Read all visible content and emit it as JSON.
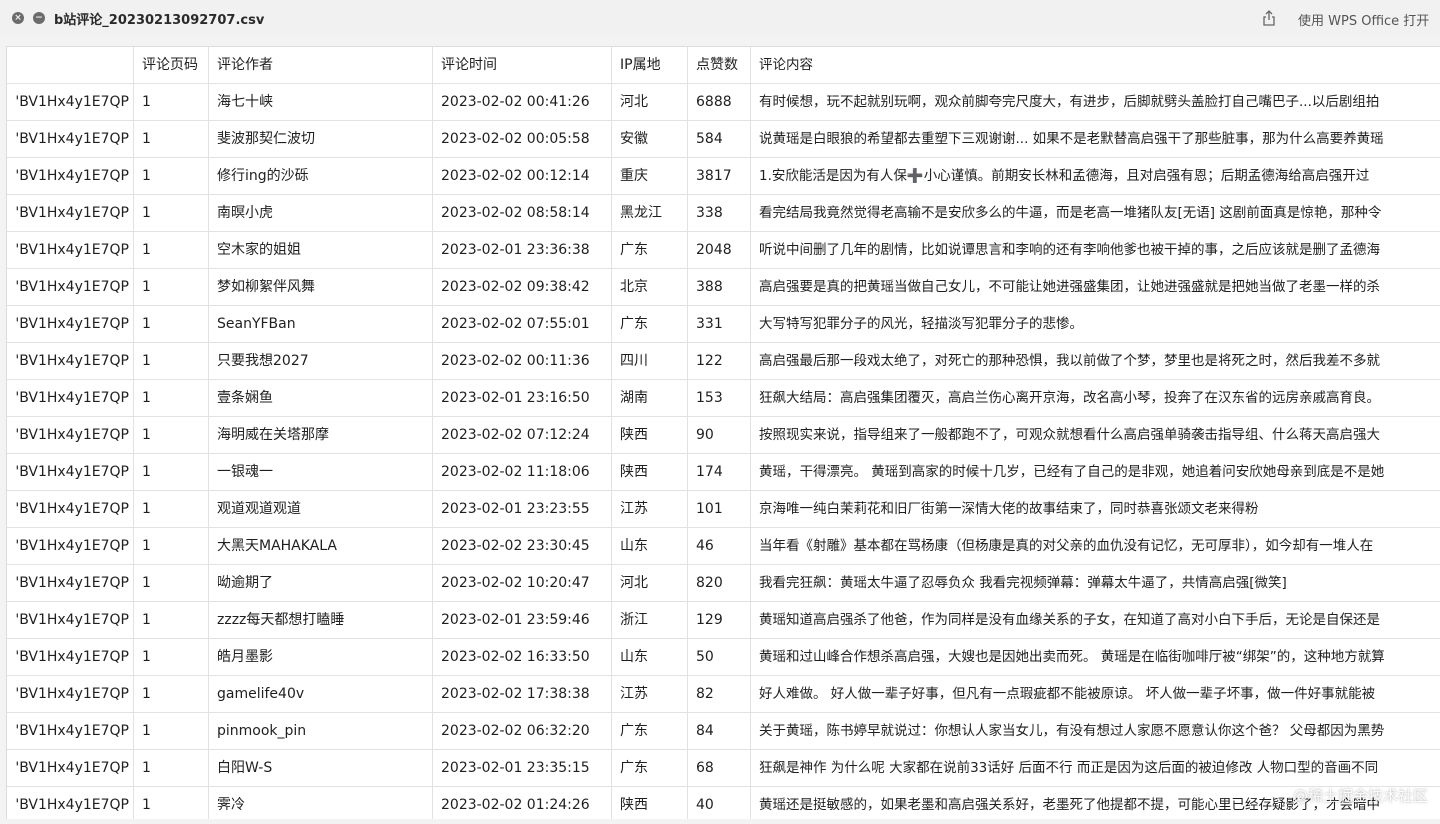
{
  "window": {
    "title": "b站评论_20230213092707.csv",
    "open_with_label": "使用 WPS Office 打开",
    "close_glyph": "×",
    "minimize_glyph": "−",
    "share_icon": "share-icon"
  },
  "table": {
    "headers": [
      "",
      "评论页码",
      "评论作者",
      "评论时间",
      "IP属地",
      "点赞数",
      "评论内容"
    ],
    "rows": [
      [
        "'BV1Hx4y1E7QP",
        "1",
        "海七十峡",
        "2023-02-02 00:41:26",
        "河北",
        "6888",
        "有时候想，玩不起就别玩啊，观众前脚夸完尺度大，有进步，后脚就劈头盖脸打自己嘴巴子...以后剧组拍"
      ],
      [
        "'BV1Hx4y1E7QP",
        "1",
        "斐波那契仁波切",
        "2023-02-02 00:05:58",
        "安徽",
        "584",
        "说黄瑶是白眼狼的希望都去重塑下三观谢谢... 如果不是老默替高启强干了那些脏事，那为什么高要养黄瑶"
      ],
      [
        "'BV1Hx4y1E7QP",
        "1",
        "修行ing的沙砾",
        "2023-02-02 00:12:14",
        "重庆",
        "3817",
        "1.安欣能活是因为有人保➕小心谨慎。前期安长林和孟德海，且对启强有恩；后期孟德海给高启强开过"
      ],
      [
        "'BV1Hx4y1E7QP",
        "1",
        "南暝小虎",
        "2023-02-02 08:58:14",
        "黑龙江",
        "338",
        "看完结局我竟然觉得老高输不是安欣多么的牛逼，而是老高一堆猪队友[无语] 这剧前面真是惊艳，那种令"
      ],
      [
        "'BV1Hx4y1E7QP",
        "1",
        "空木家的姐姐",
        "2023-02-01 23:36:38",
        "广东",
        "2048",
        "听说中间删了几年的剧情，比如说谭思言和李响的还有李响他爹也被干掉的事，之后应该就是删了孟德海"
      ],
      [
        "'BV1Hx4y1E7QP",
        "1",
        "梦如柳絮伴风舞",
        "2023-02-02 09:38:42",
        "北京",
        "388",
        "高启强要是真的把黄瑶当做自己女儿，不可能让她进强盛集团，让她进强盛就是把她当做了老墨一样的杀"
      ],
      [
        "'BV1Hx4y1E7QP",
        "1",
        "SeanYFBan",
        "2023-02-02 07:55:01",
        "广东",
        "331",
        "大写特写犯罪分子的风光，轻描淡写犯罪分子的悲惨。"
      ],
      [
        "'BV1Hx4y1E7QP",
        "1",
        "只要我想2027",
        "2023-02-02 00:11:36",
        "四川",
        "122",
        "高启强最后那一段戏太绝了，对死亡的那种恐惧，我以前做了个梦，梦里也是将死之时，然后我差不多就"
      ],
      [
        "'BV1Hx4y1E7QP",
        "1",
        "壹条娴鱼",
        "2023-02-01 23:16:50",
        "湖南",
        "153",
        "狂飙大结局：高启强集团覆灭，高启兰伤心离开京海，改名高小琴，投奔了在汉东省的远房亲戚高育良。"
      ],
      [
        "'BV1Hx4y1E7QP",
        "1",
        "海明威在关塔那摩",
        "2023-02-02 07:12:24",
        "陕西",
        "90",
        "按照现实来说，指导组来了一般都跑不了，可观众就想看什么高启强单骑袭击指导组、什么蒋天高启强大"
      ],
      [
        "'BV1Hx4y1E7QP",
        "1",
        "一银魂一",
        "2023-02-02 11:18:06",
        "陕西",
        "174",
        "黄瑶，干得漂亮。 黄瑶到高家的时候十几岁，已经有了自己的是非观，她追着问安欣她母亲到底是不是她"
      ],
      [
        "'BV1Hx4y1E7QP",
        "1",
        "观道观道观道",
        "2023-02-01 23:23:55",
        "江苏",
        "101",
        "京海唯一纯白茉莉花和旧厂街第一深情大佬的故事结束了，同时恭喜张颂文老来得粉"
      ],
      [
        "'BV1Hx4y1E7QP",
        "1",
        "大黑天MAHAKALA",
        "2023-02-02 23:30:45",
        "山东",
        "46",
        "当年看《射雕》基本都在骂杨康（但杨康是真的对父亲的血仇没有记忆，无可厚非），如今却有一堆人在"
      ],
      [
        "'BV1Hx4y1E7QP",
        "1",
        "呦逾期了",
        "2023-02-02 10:20:47",
        "河北",
        "820",
        "我看完狂飙：黄瑶太牛逼了忍辱负众 我看完视频弹幕：弹幕太牛逼了，共情高启强[微笑]"
      ],
      [
        "'BV1Hx4y1E7QP",
        "1",
        "zzzz每天都想打瞌睡",
        "2023-02-01 23:59:46",
        "浙江",
        "129",
        "黄瑶知道高启强杀了他爸，作为同样是没有血缘关系的子女，在知道了高对小白下手后，无论是自保还是"
      ],
      [
        "'BV1Hx4y1E7QP",
        "1",
        "皓月墨影",
        "2023-02-02 16:33:50",
        "山东",
        "50",
        "黄瑶和过山峰合作想杀高启强，大嫂也是因她出卖而死。 黄瑶是在临街咖啡厅被“绑架”的，这种地方就算"
      ],
      [
        "'BV1Hx4y1E7QP",
        "1",
        "gamelife40v",
        "2023-02-02 17:38:38",
        "江苏",
        "82",
        "好人难做。 好人做一辈子好事，但凡有一点瑕疵都不能被原谅。 坏人做一辈子坏事，做一件好事就能被"
      ],
      [
        "'BV1Hx4y1E7QP",
        "1",
        "pinmook_pin",
        "2023-02-02 06:32:20",
        "广东",
        "84",
        "关于黄瑶，陈书婷早就说过：你想认人家当女儿，有没有想过人家愿不愿意认你这个爸？ 父母都因为黑势"
      ],
      [
        "'BV1Hx4y1E7QP",
        "1",
        "白阳W-S",
        "2023-02-01 23:35:15",
        "广东",
        "68",
        "狂飙是神作 为什么呢 大家都在说前33话好 后面不行 而正是因为这后面的被迫修改 人物口型的音画不同"
      ],
      [
        "'BV1Hx4y1E7QP",
        "1",
        "霁冷",
        "2023-02-02 01:24:26",
        "陕西",
        "40",
        "黄瑶还是挺敏感的，如果老墨和高启强关系好，老墨死了他提都不提，可能心里已经存疑影了，才会暗中"
      ]
    ]
  },
  "watermark": "@稀土掘金技术社区"
}
